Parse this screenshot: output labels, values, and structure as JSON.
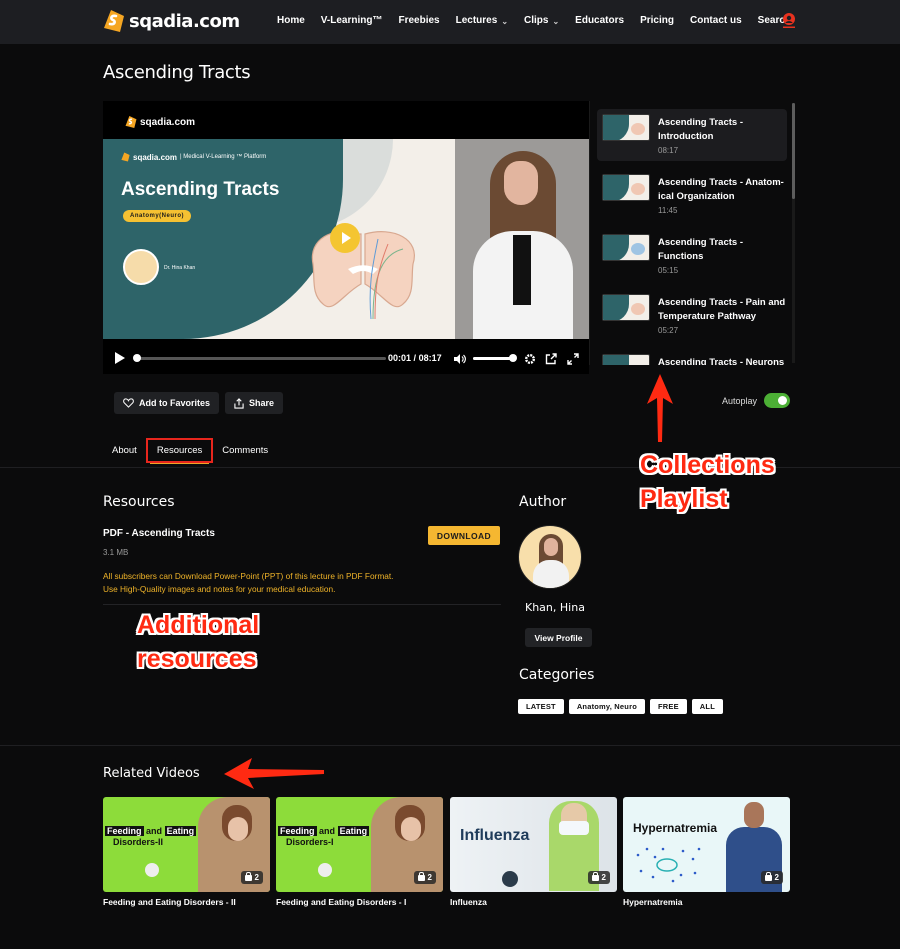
{
  "navbar": {
    "logo_text": "sqadia.com",
    "items": [
      {
        "label": "Home",
        "has_dropdown": false
      },
      {
        "label": "V-Learning™",
        "has_dropdown": false
      },
      {
        "label": "Freebies",
        "has_dropdown": false
      },
      {
        "label": "Lectures",
        "has_dropdown": true
      },
      {
        "label": "Clips",
        "has_dropdown": true
      },
      {
        "label": "Educators",
        "has_dropdown": false
      },
      {
        "label": "Pricing",
        "has_dropdown": false
      },
      {
        "label": "Contact us",
        "has_dropdown": false
      },
      {
        "label": "Search",
        "has_dropdown": false
      }
    ],
    "user_icon": "user-account-icon",
    "accent_color": "#e8321f"
  },
  "page": {
    "title": "Ascending Tracts"
  },
  "player": {
    "watermark": "sqadia.com",
    "slide": {
      "brand": "sqadia.com",
      "tagline": "| Medical V-Learning ™ Platform",
      "title": "Ascending Tracts",
      "subject_pill": "Anatomy(Neuro)",
      "presenter": "Dr. Hina Khan"
    },
    "current_time": "00:01",
    "separator": "/",
    "duration": "08:17",
    "progress_fraction": 0.002,
    "volume_fraction": 1.0
  },
  "playlist": {
    "items": [
      {
        "title": "Ascending Tracts - Introduction",
        "duration": "08:17",
        "active": true
      },
      {
        "title": "Ascending Tracts - Anatom-ical Organization",
        "duration": "11:45",
        "active": false
      },
      {
        "title": "Ascending Tracts - Functions",
        "duration": "05:15",
        "active": false
      },
      {
        "title": "Ascending Tracts - Pain and Temperature Pathway",
        "duration": "05:27",
        "active": false
      },
      {
        "title": "Ascending Tracts - Neurons",
        "duration": "",
        "active": false
      }
    ]
  },
  "actions": {
    "favorites_label": "Add to Favorites",
    "share_label": "Share",
    "autoplay_label": "Autoplay",
    "autoplay_on": true,
    "toggle_color": "#4caf35"
  },
  "tabs": [
    {
      "label": "About",
      "active": false
    },
    {
      "label": "Resources",
      "active": true
    },
    {
      "label": "Comments",
      "active": false
    }
  ],
  "resources": {
    "heading": "Resources",
    "items": [
      {
        "name": "PDF - Ascending Tracts",
        "size": "3.1 MB",
        "button_label": "DOWNLOAD"
      }
    ],
    "note_line1": "All subscribers can Download Power-Point (PPT) of this lecture in PDF Format.",
    "note_line2": "Use High-Quality images and notes for your medical education.",
    "note_color": "#f0b429"
  },
  "author": {
    "heading": "Author",
    "name": "Khan, Hina",
    "view_profile_label": "View Profile"
  },
  "categories": {
    "heading": "Categories",
    "items": [
      "LATEST",
      "Anatomy, Neuro",
      "FREE",
      "ALL"
    ]
  },
  "annotations": {
    "playlist_label_line1": "Collections",
    "playlist_label_line2": "Playlist",
    "resources_label_line1": "Additional",
    "resources_label_line2": "resources",
    "color": "#ff2a12"
  },
  "related": {
    "heading": "Related Videos",
    "videos": [
      {
        "title": "Feeding and Eating Disorders - II",
        "thumb_line1a": "Feeding",
        "thumb_line1b": "and",
        "thumb_line1c": "Eating",
        "thumb_line2": "Disorders-II",
        "count": "2"
      },
      {
        "title": "Feeding and Eating Disorders - I",
        "thumb_line1a": "Feeding",
        "thumb_line1b": "and",
        "thumb_line1c": "Eating",
        "thumb_line2": "Disorders-I",
        "count": "2"
      },
      {
        "title": "Influenza",
        "thumb_text": "Influenza",
        "count": "2"
      },
      {
        "title": "Hypernatremia",
        "thumb_text": "Hypernatremia",
        "count": "2"
      }
    ]
  }
}
